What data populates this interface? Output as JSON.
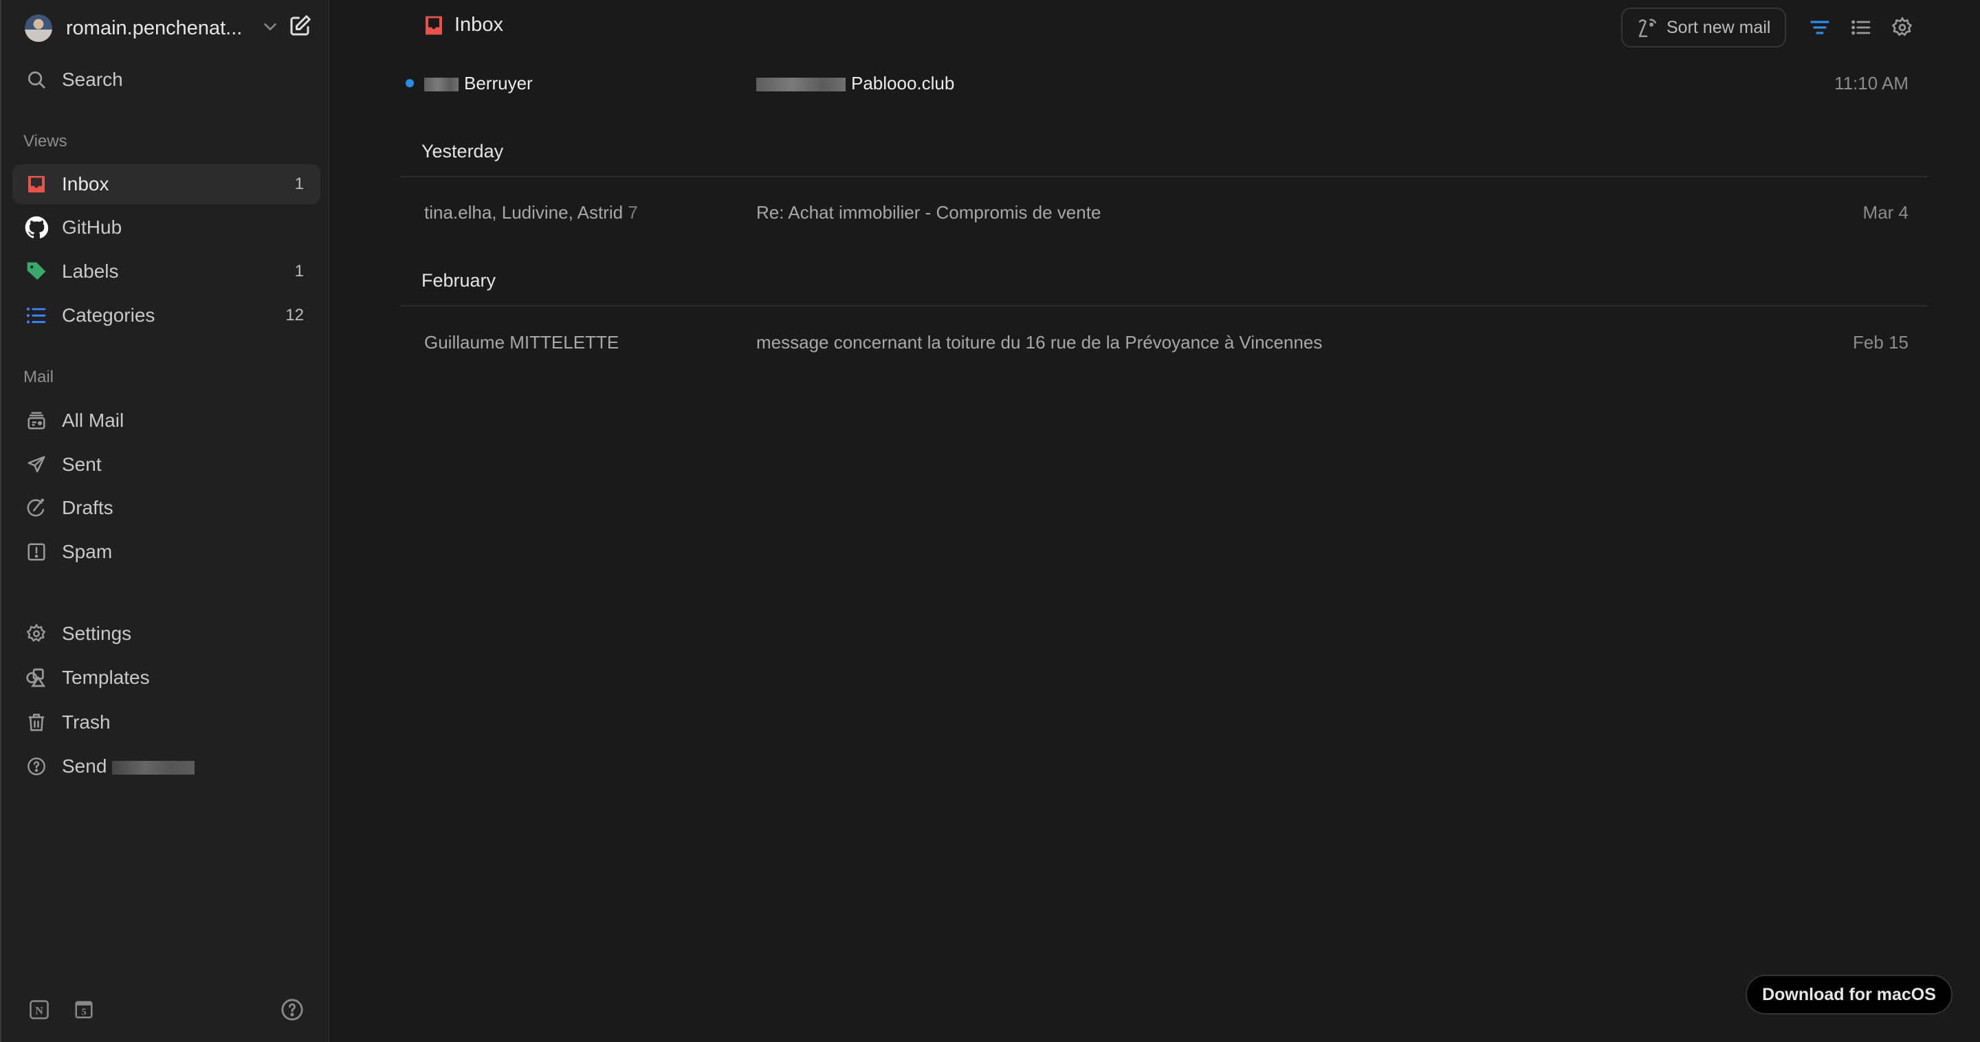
{
  "sidebar": {
    "account": {
      "name": "romain.penchenat...",
      "avatar_icon": "user-avatar"
    },
    "search": {
      "label": "Search",
      "icon": "search-icon"
    },
    "sections": {
      "views": "Views",
      "mail": "Mail"
    },
    "views": [
      {
        "label": "Inbox",
        "count": "1",
        "icon": "inbox-icon",
        "color": "#e5534b",
        "active": true
      },
      {
        "label": "GitHub",
        "count": "",
        "icon": "github-icon",
        "color": "#ffffff"
      },
      {
        "label": "Labels",
        "count": "1",
        "icon": "tag-icon",
        "color": "#3aa86b"
      },
      {
        "label": "Categories",
        "count": "12",
        "icon": "list-icon",
        "color": "#3b82f6"
      }
    ],
    "mail": [
      {
        "label": "All Mail",
        "icon": "archive-icon"
      },
      {
        "label": "Sent",
        "icon": "send-icon"
      },
      {
        "label": "Drafts",
        "icon": "draft-icon"
      },
      {
        "label": "Spam",
        "icon": "spam-icon"
      }
    ],
    "other": [
      {
        "label": "Settings",
        "icon": "gear-icon"
      },
      {
        "label": "Templates",
        "icon": "shapes-icon"
      },
      {
        "label": "Trash",
        "icon": "trash-icon"
      },
      {
        "label": "Send",
        "icon": "help-circle-icon",
        "redacted": true
      }
    ],
    "bottom": {
      "notion_glyph": "N",
      "calendar_glyph": "5"
    }
  },
  "header": {
    "title": "Inbox",
    "sort_button": "Sort new mail"
  },
  "mail_list": {
    "today": [
      {
        "sender": "Berruyer",
        "sender_redacted": true,
        "subject": "Pablooo.club",
        "subject_redacted": true,
        "date": "11:10 AM",
        "unread": true
      }
    ],
    "groups": [
      {
        "label": "Yesterday",
        "rows": [
          {
            "sender": "tina.elha, Ludivine, Astrid",
            "count": "7",
            "subject": "Re: Achat immobilier - Compromis de vente",
            "date": "Mar 4",
            "unread": false
          }
        ]
      },
      {
        "label": "February",
        "rows": [
          {
            "sender": "Guillaume MITTELETTE",
            "count": "",
            "subject": "message concernant la toiture du 16 rue de la Prévoyance à Vincennes",
            "date": "Feb 15",
            "unread": false
          }
        ]
      }
    ]
  },
  "download_button": "Download for macOS",
  "colors": {
    "accent_blue": "#2d8ce8",
    "inbox_red": "#e5534b",
    "label_green": "#3aa86b",
    "sidebar_bg": "#202020",
    "main_bg": "#1a1a1a"
  }
}
